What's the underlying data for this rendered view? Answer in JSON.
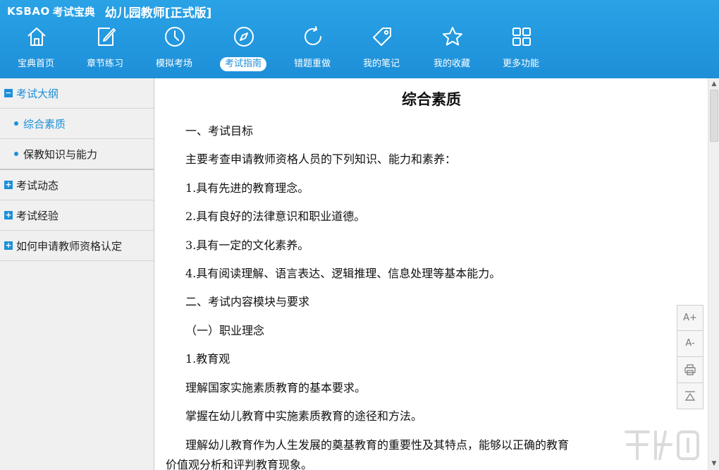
{
  "app": {
    "logo": "KSBAO",
    "logo_suffix": "考试宝典",
    "title": "幼儿园教师[正式版]"
  },
  "nav": [
    {
      "label": "宝典首页",
      "icon": "home-icon"
    },
    {
      "label": "章节练习",
      "icon": "edit-icon"
    },
    {
      "label": "模拟考场",
      "icon": "clock-icon"
    },
    {
      "label": "考试指南",
      "icon": "compass-icon",
      "active": true
    },
    {
      "label": "错题重做",
      "icon": "refresh-icon"
    },
    {
      "label": "我的笔记",
      "icon": "tag-icon"
    },
    {
      "label": "我的收藏",
      "icon": "star-icon"
    },
    {
      "label": "更多功能",
      "icon": "grid-icon"
    }
  ],
  "sidebar": {
    "items": [
      {
        "label": "考试大纲",
        "toggle": "−",
        "expanded": true
      },
      {
        "label": "综合素质",
        "sub": true,
        "selected": true
      },
      {
        "label": "保教知识与能力",
        "sub": true
      },
      {
        "label": "考试动态",
        "toggle": "+"
      },
      {
        "label": "考试经验",
        "toggle": "+"
      },
      {
        "label": "如何申请教师资格认定",
        "toggle": "+"
      }
    ]
  },
  "document": {
    "title": "综合素质",
    "paragraphs": [
      "一、考试目标",
      "主要考查申请教师资格人员的下列知识、能力和素养：",
      "1.具有先进的教育理念。",
      "2.具有良好的法律意识和职业道德。",
      "3.具有一定的文化素养。",
      "4.具有阅读理解、语言表达、逻辑推理、信息处理等基本能力。",
      "二、考试内容模块与要求",
      "（一）职业理念",
      "1.教育观",
      "理解国家实施素质教育的基本要求。",
      "掌握在幼儿教育中实施素质教育的途径和方法。",
      "理解幼儿教育作为人生发展的奠基教育的重要性及其特点，能够以正确的教育",
      "价值观分析和评判教育现象。"
    ]
  },
  "tools": {
    "font_increase": "A+",
    "font_decrease": "A-"
  },
  "colors": {
    "header": "#1d8fd8",
    "accent": "#1d8fd8",
    "sidebar_bg": "#f0f0f0"
  }
}
